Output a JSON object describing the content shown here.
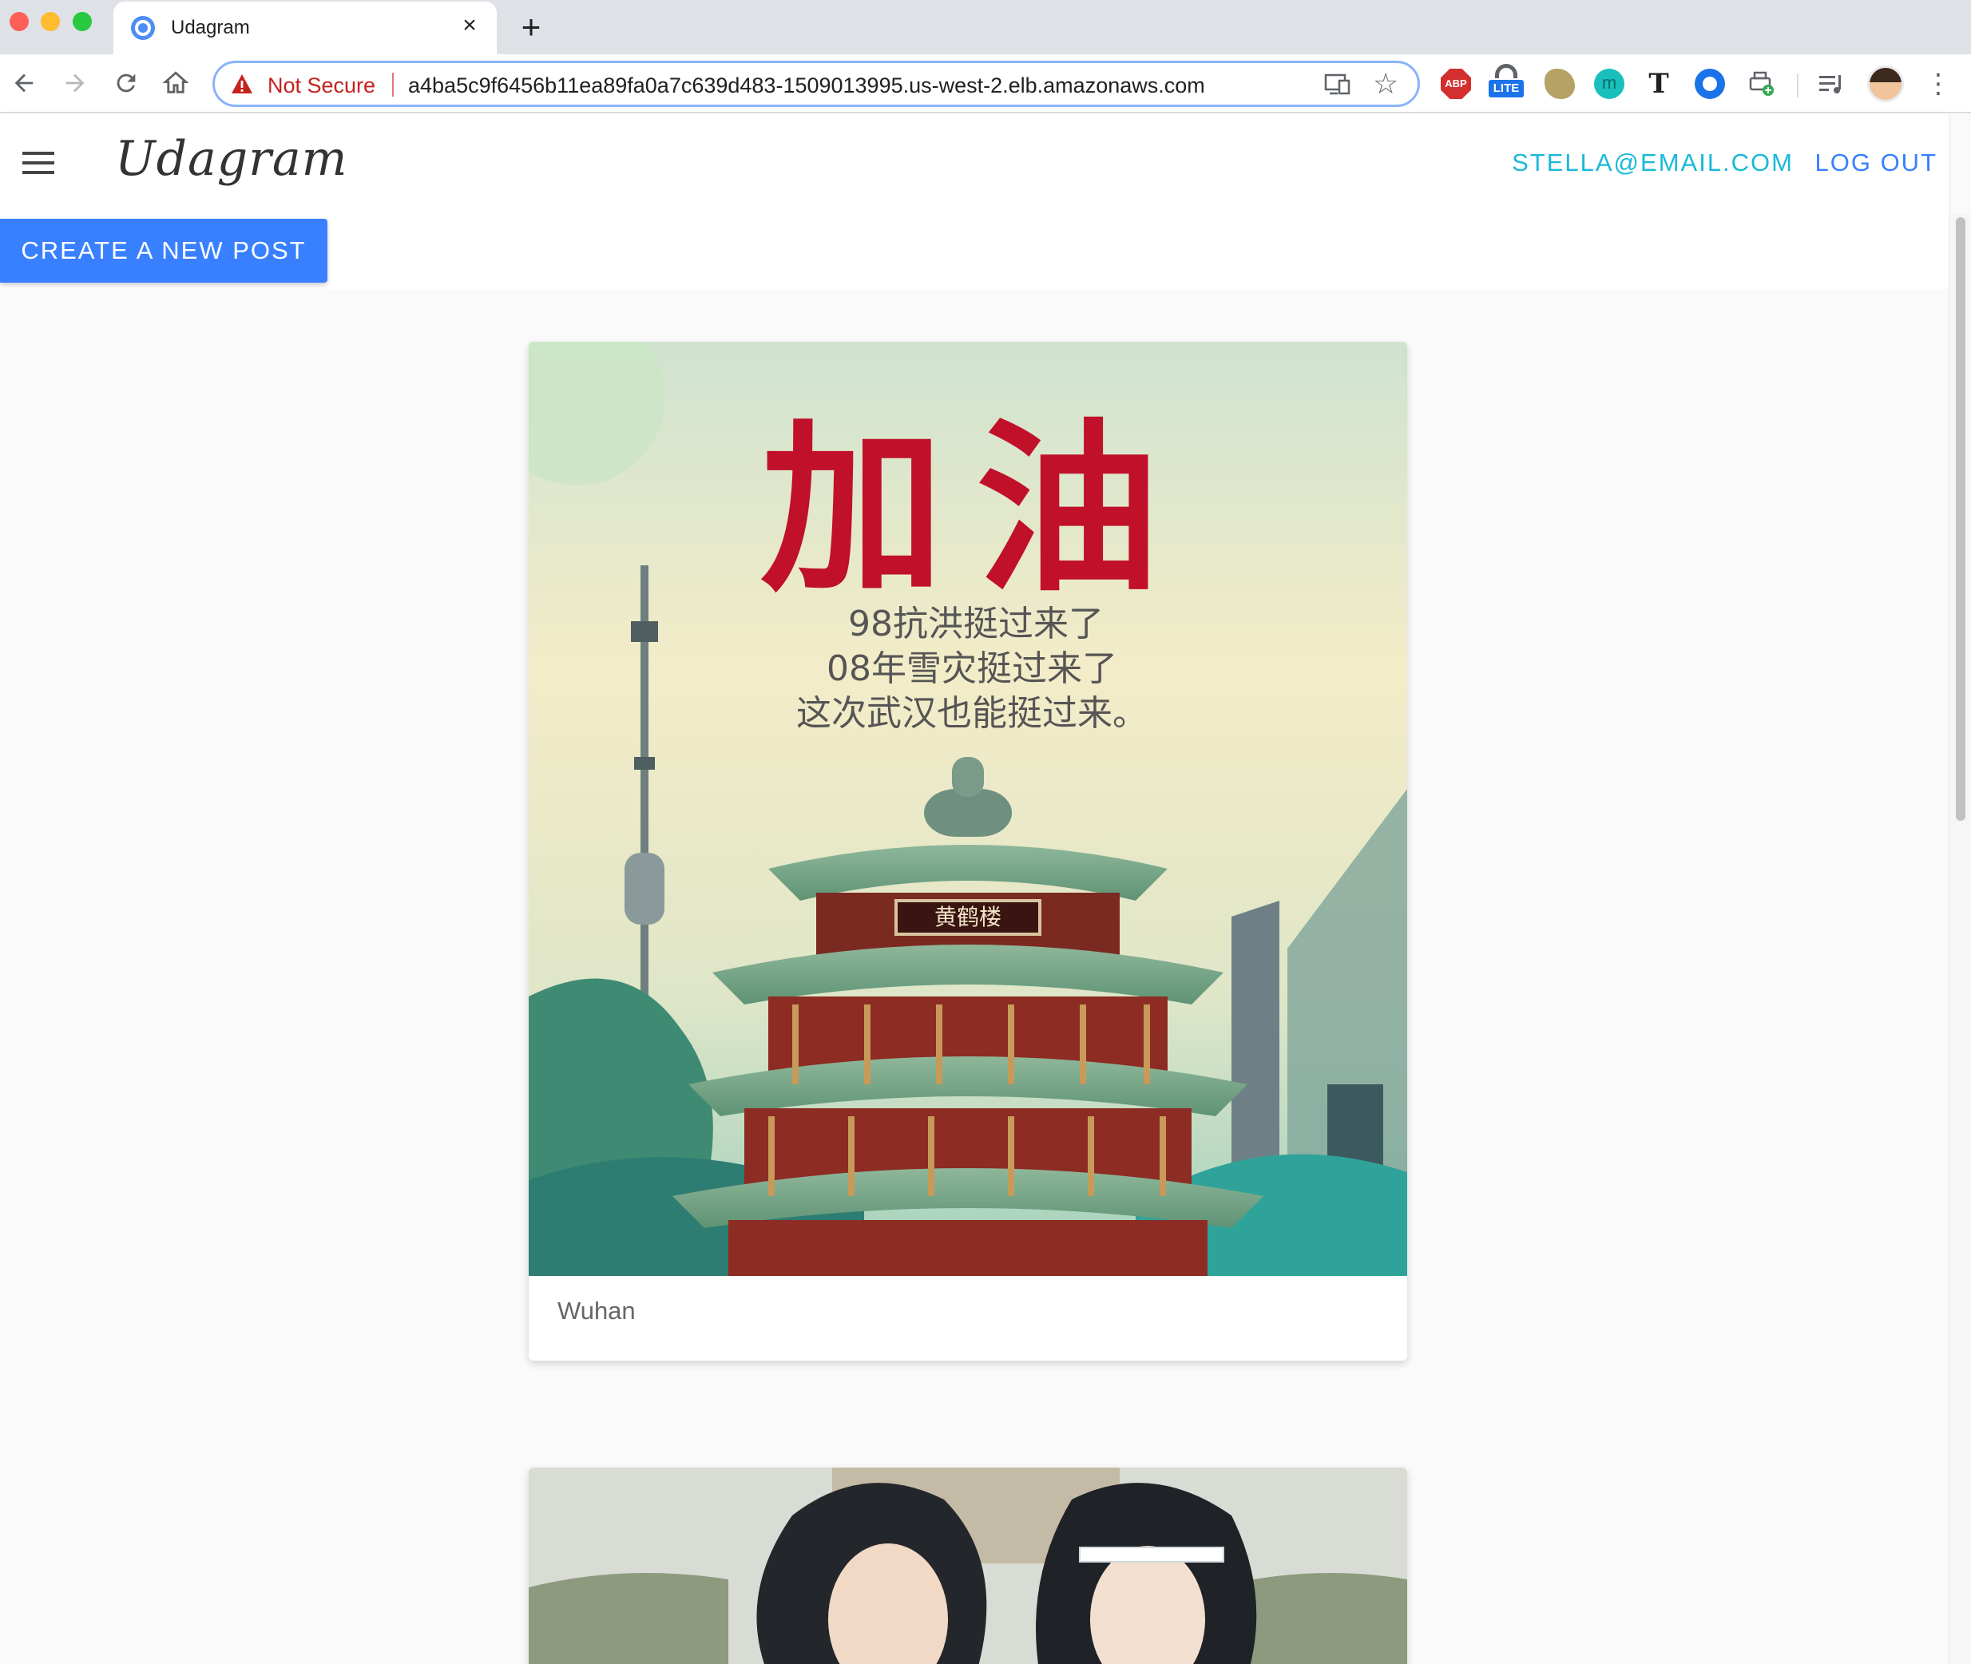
{
  "browser": {
    "tab_title": "Udagram",
    "tab_close": "×",
    "new_tab": "+",
    "security_label": "Not Secure",
    "url": "a4ba5c9f6456b11ea89fa0a7c639d483-1509013995.us-west-2.elb.amazonaws.com:8...",
    "star_glyph": "☆",
    "menu_glyph": "⋮",
    "extensions": {
      "abp_label": "ABP",
      "lite_label": "LITE",
      "m_label": "m",
      "t_label": "T"
    }
  },
  "header": {
    "brand": "Udagram",
    "user_email": "STELLA@EMAIL.COM",
    "logout": "LOG OUT"
  },
  "actions": {
    "create_post": "CREATE A NEW POST"
  },
  "feed": [
    {
      "caption": "Wuhan",
      "image": {
        "headline": "加油",
        "lines": [
          "98抗洪挺过来了",
          "08年雪灾挺过来了",
          "这次武汉也能挺过来。"
        ],
        "sign": "黄鹤楼"
      }
    },
    {
      "caption": ""
    }
  ],
  "colors": {
    "accent": "#3880ff",
    "email": "#1ab9d8",
    "not_secure": "#c5221f",
    "headline_red": "#c0102a"
  },
  "icons": [
    "menu-icon",
    "back-arrow-icon",
    "forward-arrow-icon",
    "reload-icon",
    "home-icon",
    "warning-icon",
    "cast-icon",
    "star-icon",
    "chrome-menu-icon"
  ]
}
